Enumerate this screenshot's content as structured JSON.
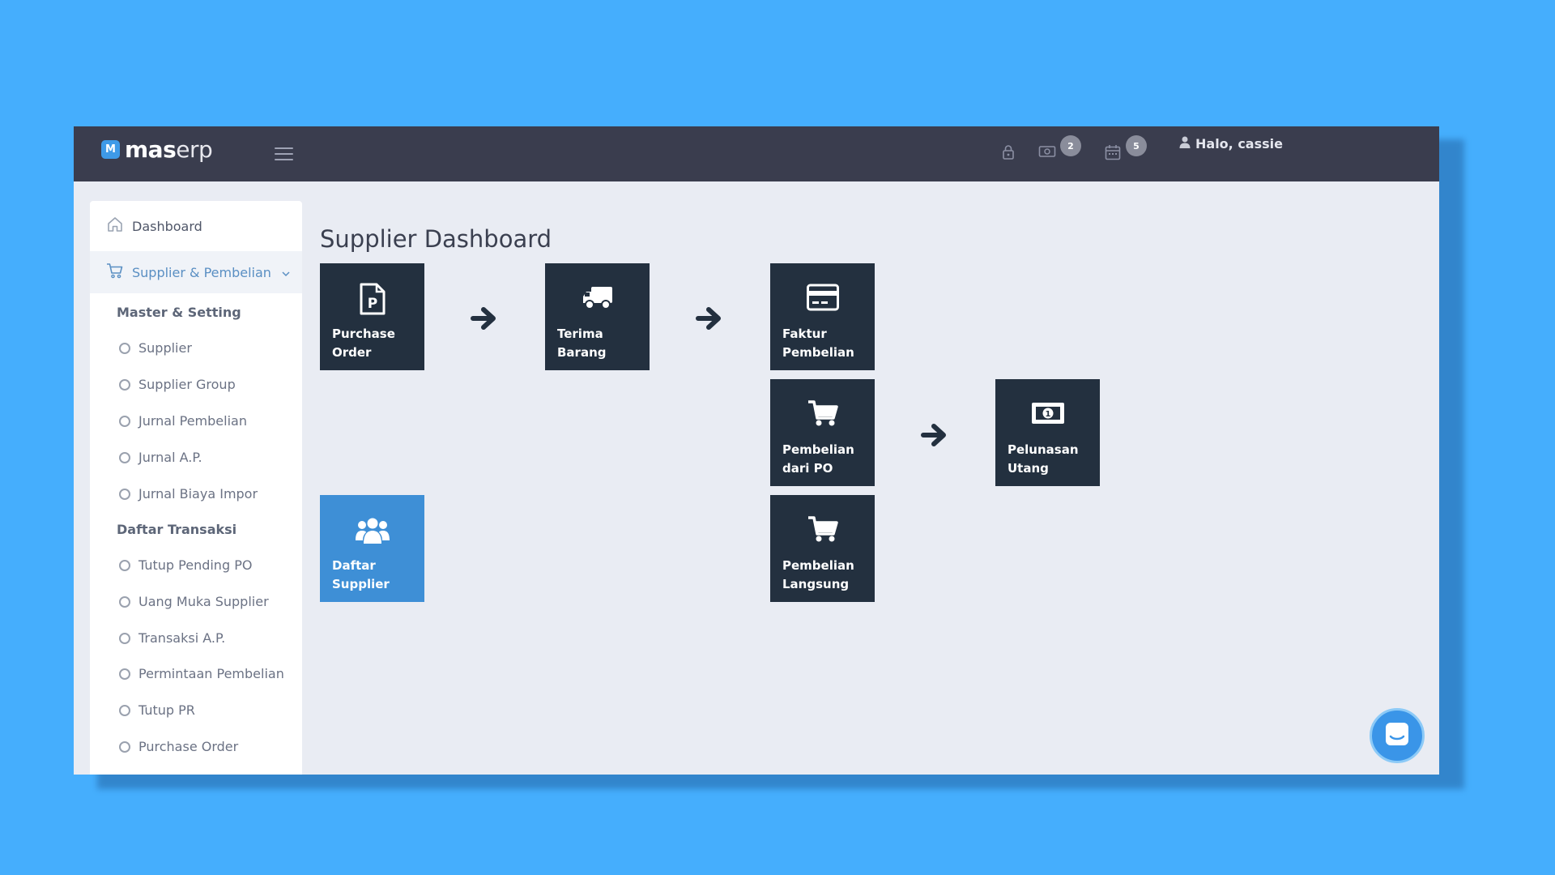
{
  "topbar": {
    "logo_mark": "M",
    "logo_bold": "mas",
    "logo_light": "erp",
    "icons": [
      "lock-icon",
      "money-icon",
      "calendar-icon"
    ],
    "money_badge": "2",
    "calendar_badge": "5",
    "greeting": "Halo, cassie"
  },
  "sidebar": {
    "dashboard_label": "Dashboard",
    "module_label": "Supplier & Pembelian",
    "sections": [
      {
        "title": "Master & Setting",
        "items": [
          "Supplier",
          "Supplier Group",
          "Jurnal Pembelian",
          "Jurnal A.P.",
          "Jurnal Biaya Impor"
        ]
      },
      {
        "title": "Daftar Transaksi",
        "items": [
          "Tutup Pending PO",
          "Uang Muka Supplier",
          "Transaksi A.P.",
          "Permintaan Pembelian",
          "Tutup PR",
          "Purchase Order"
        ]
      }
    ]
  },
  "main": {
    "title": "Supplier Dashboard",
    "tiles": [
      {
        "line1": "Purchase",
        "line2": "Order",
        "icon": "document-p-icon"
      },
      {
        "line1": "Terima",
        "line2": "Barang",
        "icon": "truck-icon"
      },
      {
        "line1": "Faktur",
        "line2": "Pembelian",
        "icon": "credit-card-icon"
      },
      {
        "line1": "Pembelian",
        "line2": "dari PO",
        "icon": "cart-icon"
      },
      {
        "line1": "Pelunasan",
        "line2": "Utang",
        "icon": "money-bill-icon"
      },
      {
        "line1": "Daftar",
        "line2": "Supplier",
        "icon": "users-icon"
      },
      {
        "line1": "Pembelian",
        "line2": "Langsung",
        "icon": "cart-icon"
      }
    ]
  },
  "colors": {
    "background": "#45aefd",
    "topbar": "#3a3d4e",
    "tile_dark": "#23303f",
    "tile_blue": "#3e8fd6",
    "accent": "#5a8fc3"
  }
}
